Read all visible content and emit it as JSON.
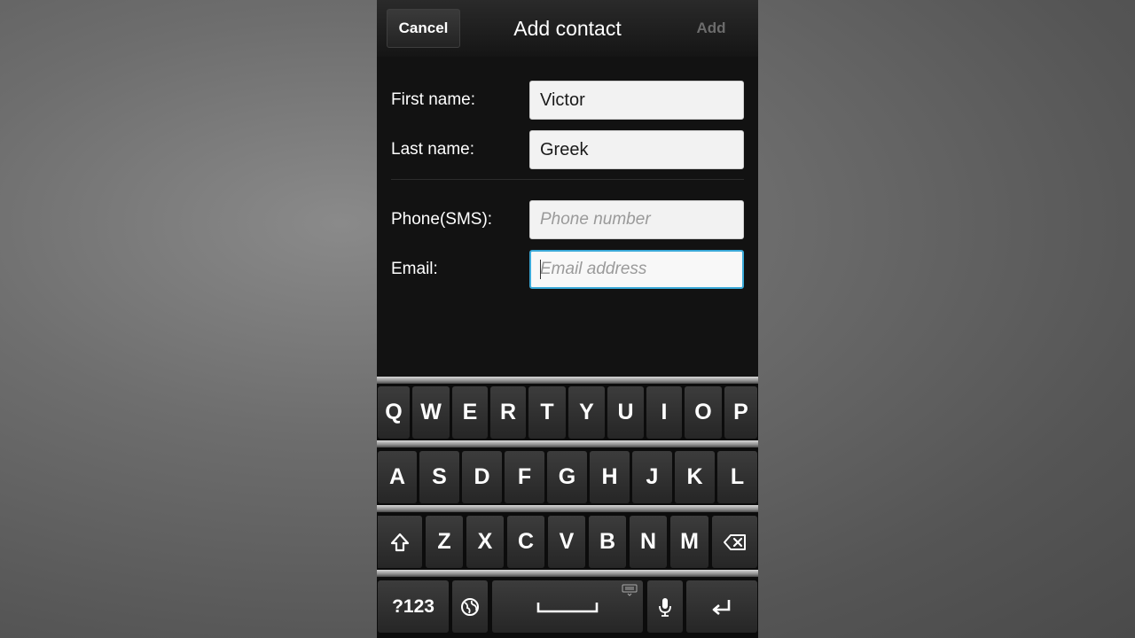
{
  "header": {
    "cancel_label": "Cancel",
    "title": "Add contact",
    "add_label": "Add"
  },
  "form": {
    "first_name": {
      "label": "First name:",
      "value": "Victor"
    },
    "last_name": {
      "label": "Last name:",
      "value": "Greek"
    },
    "phone": {
      "label": "Phone(SMS):",
      "placeholder": "Phone number"
    },
    "email": {
      "label": "Email:",
      "placeholder": "Email address"
    }
  },
  "keyboard": {
    "row1": [
      "Q",
      "W",
      "E",
      "R",
      "T",
      "Y",
      "U",
      "I",
      "O",
      "P"
    ],
    "row2": [
      "A",
      "S",
      "D",
      "F",
      "G",
      "H",
      "J",
      "K",
      "L"
    ],
    "row3": [
      "Z",
      "X",
      "C",
      "V",
      "B",
      "N",
      "M"
    ],
    "symbols_label": "?123",
    "icons": {
      "shift": "shift-icon",
      "backspace": "backspace-icon",
      "globe": "globe-icon",
      "space": "space-bar",
      "mic": "mic-icon",
      "enter": "enter-icon"
    }
  }
}
